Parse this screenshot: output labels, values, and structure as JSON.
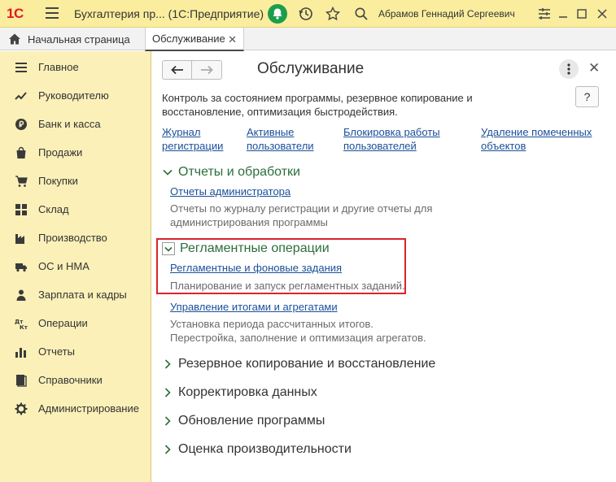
{
  "titlebar": {
    "logo": "1С",
    "app_title": "Бухгалтерия пр...  (1С:Предприятие)",
    "user_name": "Абрамов Геннадий Сергеевич"
  },
  "tabs": {
    "home_label": "Начальная страница",
    "active_label": "Обслуживание",
    "close_glyph": "✕"
  },
  "sidebar": {
    "items": [
      {
        "label": "Главное",
        "icon": "menu-lines-icon"
      },
      {
        "label": "Руководителю",
        "icon": "trend-line-icon"
      },
      {
        "label": "Банк и касса",
        "icon": "ruble-coin-icon"
      },
      {
        "label": "Продажи",
        "icon": "shopping-bag-icon"
      },
      {
        "label": "Покупки",
        "icon": "shopping-cart-icon"
      },
      {
        "label": "Склад",
        "icon": "warehouse-grid-icon"
      },
      {
        "label": "Производство",
        "icon": "factory-icon"
      },
      {
        "label": "ОС и НМА",
        "icon": "truck-icon"
      },
      {
        "label": "Зарплата и кадры",
        "icon": "person-icon"
      },
      {
        "label": "Операции",
        "icon": "debit-credit-icon"
      },
      {
        "label": "Отчеты",
        "icon": "bar-chart-icon"
      },
      {
        "label": "Справочники",
        "icon": "book-icon"
      },
      {
        "label": "Администрирование",
        "icon": "gear-icon"
      }
    ]
  },
  "main": {
    "back_glyph": "🡐",
    "forward_glyph": "🡒",
    "title": "Обслуживание",
    "help_label": "?",
    "close_glyph": "✕",
    "description": "Контроль за состоянием программы, резервное копирование и восстановление, оптимизация быстродействия.",
    "top_links": [
      {
        "line1": "Журнал",
        "line2": "регистрации"
      },
      {
        "line1": "Активные",
        "line2": "пользователи"
      },
      {
        "line1": "Блокировка работы",
        "line2": "пользователей"
      },
      {
        "line1": "Удаление помеченных",
        "line2": "объектов"
      }
    ],
    "sections": {
      "reports": {
        "title": "Отчеты и обработки",
        "link": "Отчеты администратора",
        "desc1": "Отчеты по журналу регистрации и другие отчеты для",
        "desc2": "администрирования программы"
      },
      "routine": {
        "title": "Регламентные операции",
        "link1": "Регламентные и фоновые задания",
        "desc1": "Планирование и запуск регламентных заданий.",
        "link2": "Управление итогами и агрегатами",
        "desc2a": "Установка периода рассчитанных итогов.",
        "desc2b": "Перестройка, заполнение и оптимизация агрегатов."
      },
      "backup": {
        "title": "Резервное копирование и восстановление"
      },
      "correction": {
        "title": "Корректировка данных"
      },
      "update": {
        "title": "Обновление программы"
      },
      "performance": {
        "title": "Оценка производительности"
      }
    }
  },
  "colors": {
    "titlebar_bg": "#fbed9e",
    "sidebar_bg": "#fbf0b8",
    "link": "#1a4f9a",
    "section_green": "#2c6e3b",
    "highlight_red": "#d9242a",
    "bell_green": "#1b9e4b"
  }
}
